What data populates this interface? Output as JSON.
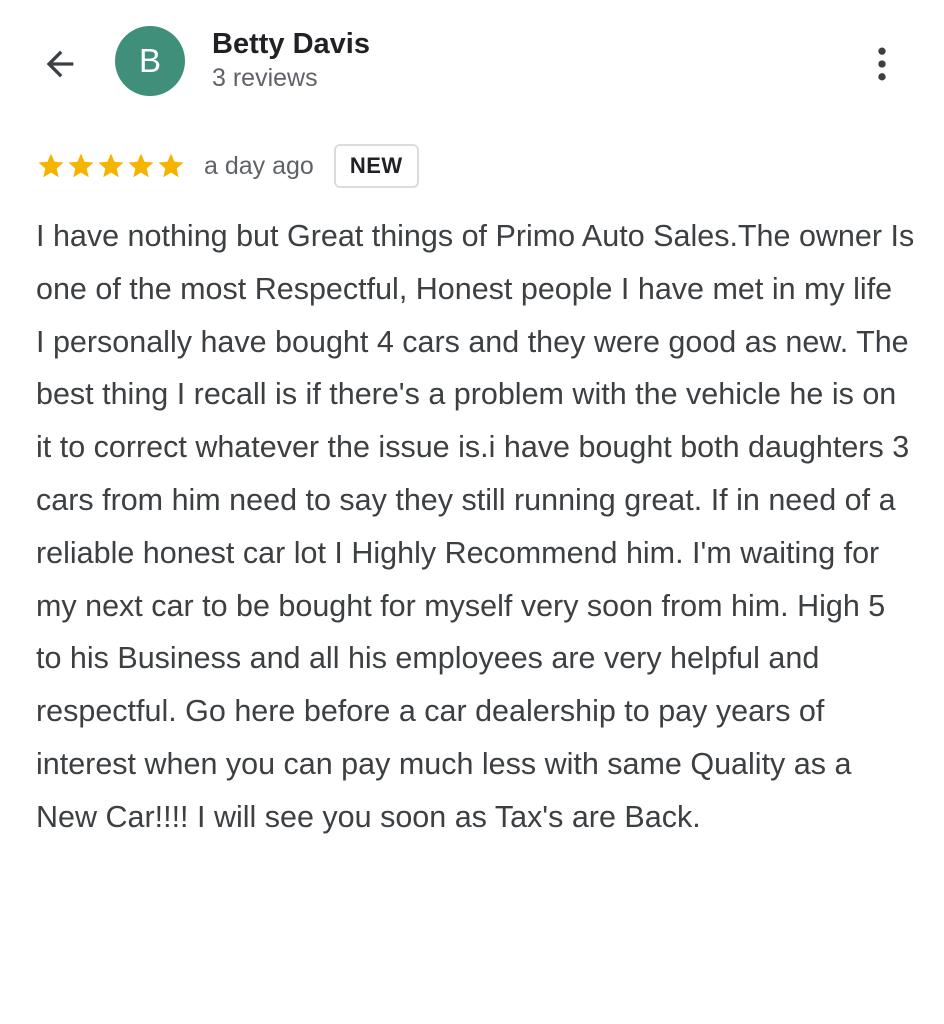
{
  "header": {
    "back_icon": "arrow-back-icon",
    "avatar_letter": "B",
    "avatar_color": "#3f8f7a",
    "user_name": "Betty Davis",
    "review_count": "3 reviews",
    "more_icon": "more-vert-icon"
  },
  "review": {
    "rating": 5,
    "rating_max": 5,
    "star_color": "#f4b400",
    "time_ago": "a day ago",
    "badge": "NEW",
    "text": "I have nothing but Great things of Primo Auto Sales.The owner Is one of the most Respectful, Honest people I have met in my life\nI personally have bought 4 cars and they were good as new. The best thing I recall is if there's a problem with the vehicle he is on it to correct whatever the issue is.i have bought both daughters 3 cars from him need to say they still running great. If in need of a reliable honest car lot I Highly Recommend him. I'm waiting for my next car to be bought for myself very soon from him. High 5 to his Business and all his employees are very helpful and respectful. Go here before a car dealership to pay years of interest when you can pay much less with same Quality as a New Car!!!! I will see you soon as Tax's are Back."
  }
}
